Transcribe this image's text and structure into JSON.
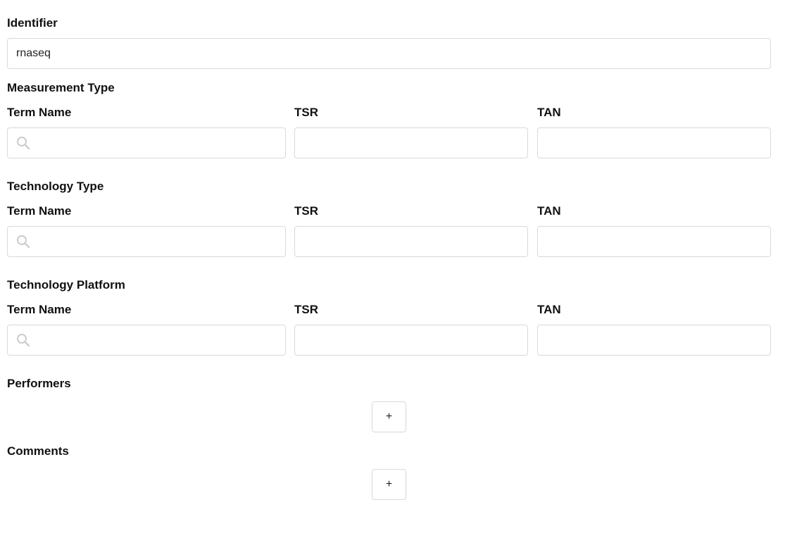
{
  "identifier": {
    "label": "Identifier",
    "value": "rnaseq"
  },
  "column_labels": {
    "term_name": "Term Name",
    "tsr": "TSR",
    "tan": "TAN"
  },
  "ontology_sections": [
    {
      "title": "Measurement Type",
      "term_name": "",
      "tsr": "",
      "tan": ""
    },
    {
      "title": "Technology Type",
      "term_name": "",
      "tsr": "",
      "tan": ""
    },
    {
      "title": "Technology Platform",
      "term_name": "",
      "tsr": "",
      "tan": ""
    }
  ],
  "performers": {
    "title": "Performers",
    "add_label": "+"
  },
  "comments": {
    "title": "Comments",
    "add_label": "+"
  },
  "icons": {
    "term_search": "search-icon"
  },
  "colors": {
    "border": "#d9d9d9",
    "icon": "#cccccc",
    "text": "#111111"
  }
}
